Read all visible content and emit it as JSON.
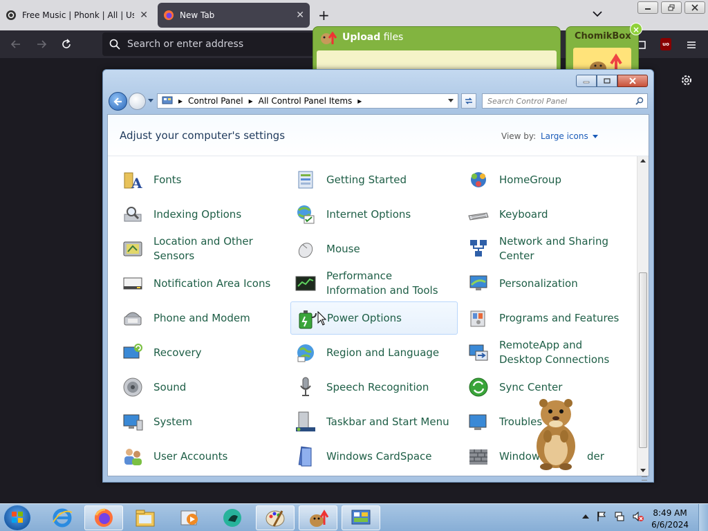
{
  "firefox": {
    "tabs": [
      {
        "title": "Free Music | Phonk | All | Use W",
        "active": false
      },
      {
        "title": "New Tab",
        "active": true
      }
    ],
    "url_placeholder": "Search or enter address",
    "ublock_label": "uo",
    "accent": "#42414d"
  },
  "upload_window": {
    "title_bold": "Upload",
    "title_rest": "files"
  },
  "chomikbox": {
    "title": "ChomikBox",
    "close": "×"
  },
  "control_panel": {
    "breadcrumb": [
      "Control Panel",
      "All Control Panel Items"
    ],
    "search_placeholder": "Search Control Panel",
    "heading": "Adjust your computer's settings",
    "view_by_label": "View by:",
    "view_by_value": "Large icons",
    "items": [
      {
        "label": "Fonts",
        "icon": "fonts-icon"
      },
      {
        "label": "Getting Started",
        "icon": "getting-started-icon"
      },
      {
        "label": "HomeGroup",
        "icon": "homegroup-icon"
      },
      {
        "label": "Indexing Options",
        "icon": "indexing-icon"
      },
      {
        "label": "Internet Options",
        "icon": "internet-options-icon"
      },
      {
        "label": "Keyboard",
        "icon": "keyboard-icon"
      },
      {
        "label": "Location and Other Sensors",
        "icon": "sensors-icon"
      },
      {
        "label": "Mouse",
        "icon": "mouse-icon"
      },
      {
        "label": "Network and Sharing Center",
        "icon": "network-icon"
      },
      {
        "label": "Notification Area Icons",
        "icon": "notification-icon"
      },
      {
        "label": "Performance Information and Tools",
        "icon": "performance-icon"
      },
      {
        "label": "Personalization",
        "icon": "personalization-icon"
      },
      {
        "label": "Phone and Modem",
        "icon": "phone-icon"
      },
      {
        "label": "Power Options",
        "icon": "power-icon"
      },
      {
        "label": "Programs and Features",
        "icon": "programs-icon"
      },
      {
        "label": "Recovery",
        "icon": "recovery-icon"
      },
      {
        "label": "Region and Language",
        "icon": "region-icon"
      },
      {
        "label": "RemoteApp and Desktop Connections",
        "icon": "remoteapp-icon"
      },
      {
        "label": "Sound",
        "icon": "sound-icon"
      },
      {
        "label": "Speech Recognition",
        "icon": "speech-icon"
      },
      {
        "label": "Sync Center",
        "icon": "sync-icon"
      },
      {
        "label": "System",
        "icon": "system-icon"
      },
      {
        "label": "Taskbar and Start Menu",
        "icon": "taskbar-icon"
      },
      {
        "label": "Troubles",
        "icon": "troubleshooting-icon"
      },
      {
        "label": "User Accounts",
        "icon": "user-accounts-icon"
      },
      {
        "label": "Windows CardSpace",
        "icon": "cardspace-icon"
      },
      {
        "label": "Windows",
        "label_tail": "der",
        "icon": "firewall-icon"
      }
    ],
    "hovered_item": "Power Options",
    "link_color": "#1e5e46",
    "heading_color": "#1e395b"
  },
  "taskbar": {
    "apps": [
      "internet-explorer-icon",
      "firefox-icon",
      "explorer-icon",
      "media-player-icon",
      "chomik-app-icon",
      "paint-icon",
      "chomikbox-icon",
      "control-panel-icon"
    ],
    "time": "8:49 AM",
    "date": "6/6/2024"
  }
}
